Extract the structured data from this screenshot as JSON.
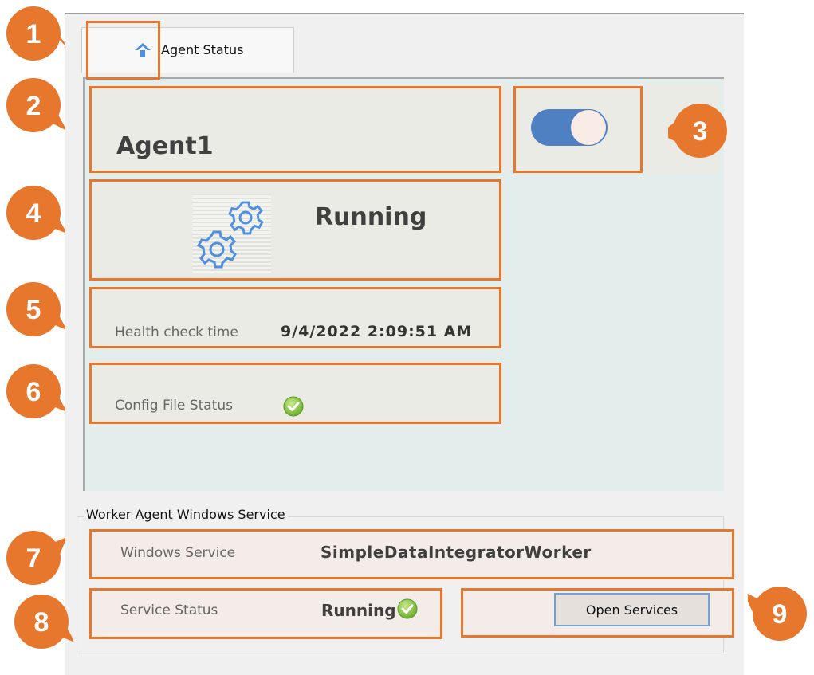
{
  "tab": {
    "label": "Agent Status"
  },
  "agent": {
    "name": "Agent1",
    "enabled": true
  },
  "status": {
    "text": "Running"
  },
  "health": {
    "label": "Health check time",
    "value": "9/4/2022 2:09:51  AM"
  },
  "config": {
    "label": "Config File Status"
  },
  "service_group": {
    "title": "Worker Agent Windows Service",
    "windows_service_label": "Windows Service",
    "windows_service_value": "SimpleDataIntegratorWorker",
    "service_status_label": "Service Status",
    "service_status_value": "Running",
    "open_button": "Open Services"
  },
  "callouts": [
    "1",
    "2",
    "3",
    "4",
    "5",
    "6",
    "7",
    "8",
    "9"
  ],
  "colors": {
    "callout": "#e8772e",
    "toggle_on": "#4f81c2",
    "panel": "#e3eeec",
    "check": "#8bc34a"
  },
  "icons": [
    "home-icon",
    "gears-icon",
    "check-circle-icon"
  ]
}
